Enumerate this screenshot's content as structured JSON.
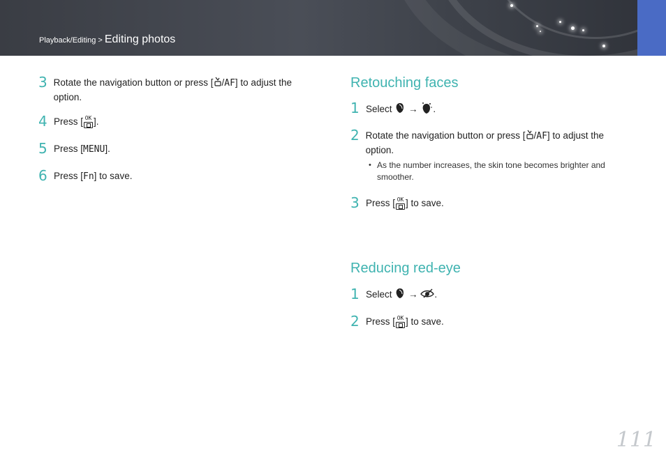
{
  "header": {
    "breadcrumb_section": "Playback/Editing",
    "breadcrumb_separator": " > ",
    "breadcrumb_page": "Editing photos",
    "accent_color": "#4a6bc5"
  },
  "left_steps": [
    {
      "num": "3",
      "text_before": "Rotate the navigation button or press [",
      "text_after": "] to adjust the option.",
      "icons": [
        "timer-af-icon"
      ]
    },
    {
      "num": "4",
      "text_before": "Press [",
      "text_after": "].",
      "icons": [
        "ok-button-icon"
      ]
    },
    {
      "num": "5",
      "text_before": "Press [",
      "key": "MENU",
      "text_after": "]."
    },
    {
      "num": "6",
      "text_before": "Press [",
      "key": "Fn",
      "text_after": "] to save."
    }
  ],
  "retouching": {
    "heading": "Retouching faces",
    "steps": [
      {
        "num": "1",
        "text_before": "Select ",
        "arrow": "→",
        "text_after": "."
      },
      {
        "num": "2",
        "text_before": "Rotate the navigation button or press [",
        "text_after": "] to adjust the option."
      },
      {
        "num": "3",
        "text_before": "Press [",
        "text_after": "] to save."
      }
    ],
    "note": "As the number increases, the skin tone becomes brighter and smoother."
  },
  "redeye": {
    "heading": "Reducing red-eye",
    "steps": [
      {
        "num": "1",
        "text_before": "Select ",
        "arrow": "→",
        "text_after": "."
      },
      {
        "num": "2",
        "text_before": "Press [",
        "text_after": "] to save."
      }
    ]
  },
  "icons": {
    "af_label": "AF",
    "slash": "/",
    "ok_label": "OK"
  },
  "page_number": "111",
  "accent_color": "#3fb3b0"
}
